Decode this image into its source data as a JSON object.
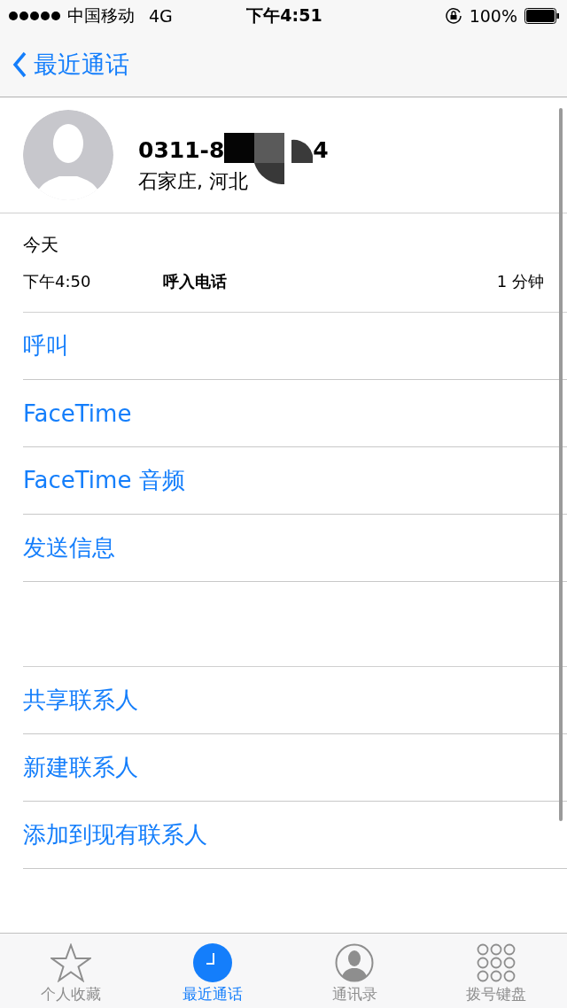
{
  "status_bar": {
    "carrier": "中国移动",
    "network": "4G",
    "time": "下午4:51",
    "battery": "100%"
  },
  "nav": {
    "back": "最近通话"
  },
  "contact": {
    "number_start": "0311-8",
    "number_end": "4",
    "location": "石家庄, 河北"
  },
  "call_log": {
    "day": "今天",
    "entries": [
      {
        "time": "下午4:50",
        "type": "呼入电话",
        "duration": "1 分钟"
      }
    ]
  },
  "actions": [
    {
      "label": "呼叫"
    },
    {
      "label": "FaceTime"
    },
    {
      "label": "FaceTime 音频"
    },
    {
      "label": "发送信息"
    }
  ],
  "contact_actions": [
    {
      "label": "共享联系人"
    },
    {
      "label": "新建联系人"
    },
    {
      "label": "添加到现有联系人"
    }
  ],
  "tabs": [
    {
      "kind": "favorites",
      "label": "个人收藏",
      "selected": false
    },
    {
      "kind": "recents",
      "label": "最近通话",
      "selected": true
    },
    {
      "kind": "contacts",
      "label": "通讯录",
      "selected": false
    },
    {
      "kind": "keypad",
      "label": "拨号键盘",
      "selected": false
    }
  ]
}
